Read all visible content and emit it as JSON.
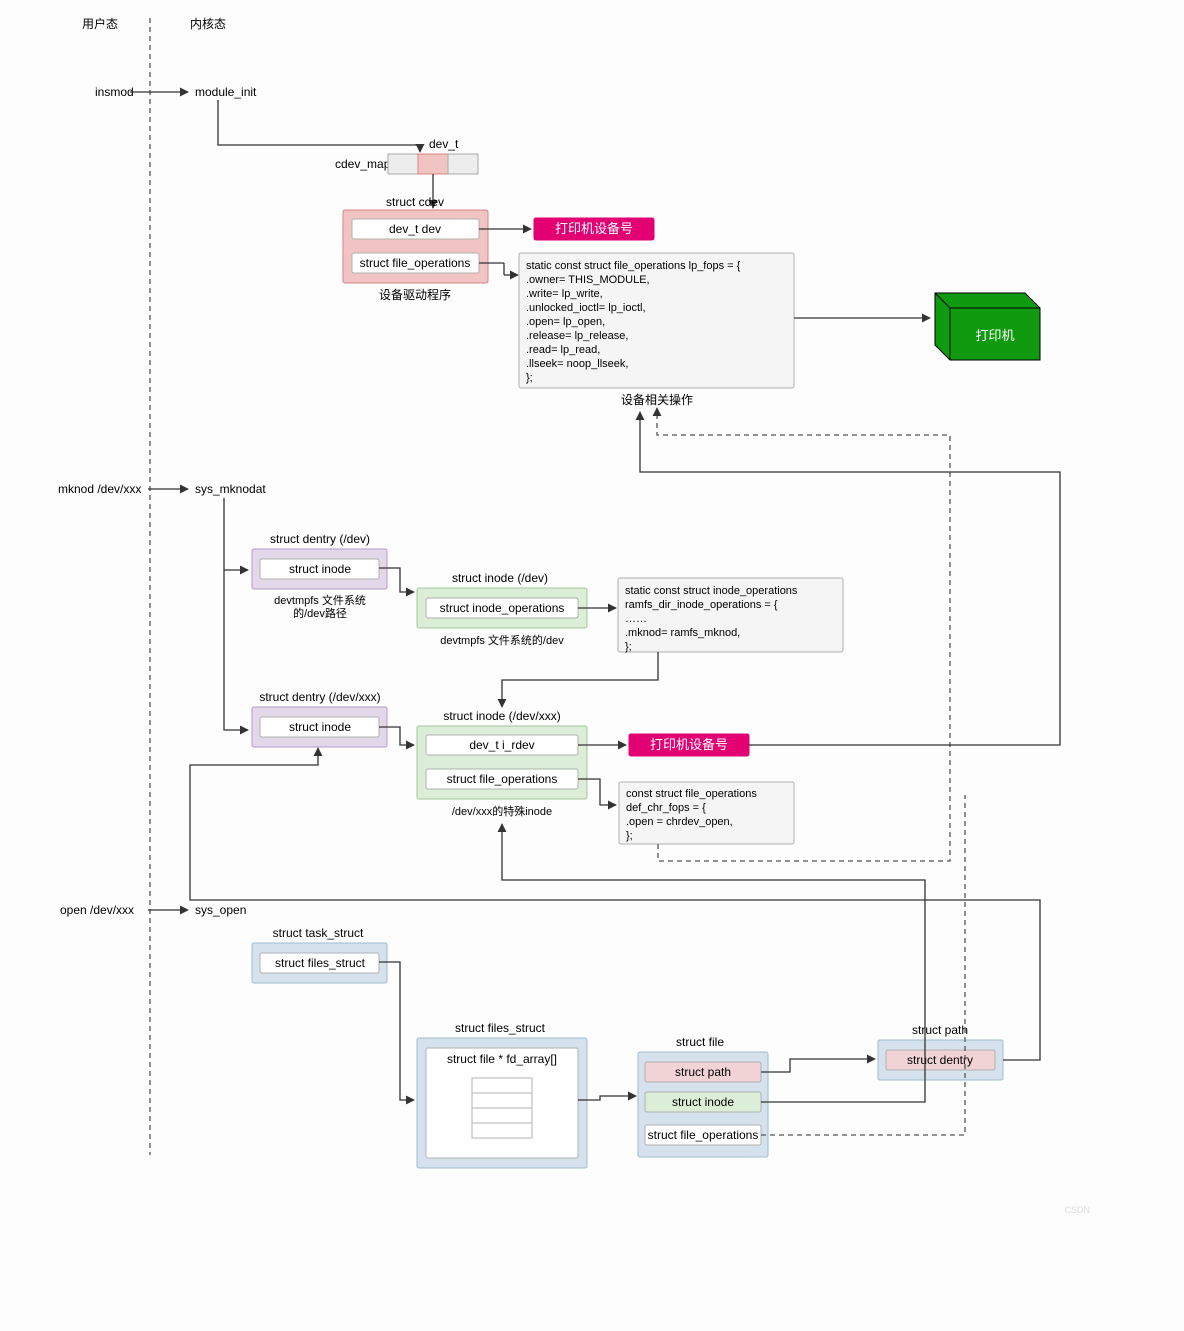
{
  "headers": {
    "user_space": "用户态",
    "kernel_space": "内核态"
  },
  "flow1": {
    "cmd": "insmod",
    "kentry": "module_init",
    "dev_t": "dev_t",
    "cdev_map": "cdev_map",
    "cdev_title": "struct cdev",
    "cdev_field1": "dev_t dev",
    "cdev_field2": "struct file_operations",
    "cdev_caption": "设备驱动程序",
    "badge": "打印机设备号",
    "code": "static const struct file_operations lp_fops = {\n.owner= THIS_MODULE,\n.write= lp_write,\n.unlocked_ioctl= lp_ioctl,\n.open= lp_open,\n.release= lp_release,\n.read= lp_read,\n.llseek= noop_llseek,\n};",
    "code_caption": "设备相关操作",
    "device": "打印机"
  },
  "flow2": {
    "cmd": "mknod /dev/xxx",
    "kentry": "sys_mknodat",
    "dentry_dev_title": "struct dentry (/dev)",
    "dentry_dev_field": "struct inode",
    "dentry_dev_caption": "devtmpfs 文件系统\n的/dev路径",
    "inode_dev_title": "struct inode (/dev)",
    "inode_dev_field": "struct inode_operations",
    "inode_dev_caption": "devtmpfs 文件系统的/dev",
    "code1": "static const struct inode_operations\nramfs_dir_inode_operations = {\n……\n.mknod= ramfs_mknod,\n};",
    "dentry_xxx_title": "struct dentry (/dev/xxx)",
    "dentry_xxx_field": "struct inode",
    "inode_xxx_title": "struct inode (/dev/xxx)",
    "inode_xxx_field1": "dev_t i_rdev",
    "inode_xxx_field2": "struct file_operations",
    "inode_xxx_caption": "/dev/xxx的特殊inode",
    "badge": "打印机设备号",
    "code2": "const struct file_operations\ndef_chr_fops = {\n.open = chrdev_open,\n};"
  },
  "flow3": {
    "cmd": "open /dev/xxx",
    "kentry": "sys_open",
    "task_title": "struct task_struct",
    "task_field": "struct files_struct",
    "files_title": "struct files_struct",
    "files_field": "struct file * fd_array[]",
    "file_title": "struct file",
    "file_f1": "struct path",
    "file_f2": "struct inode",
    "file_f3": "struct file_operations",
    "path_title": "struct path",
    "path_field": "struct dentry"
  }
}
